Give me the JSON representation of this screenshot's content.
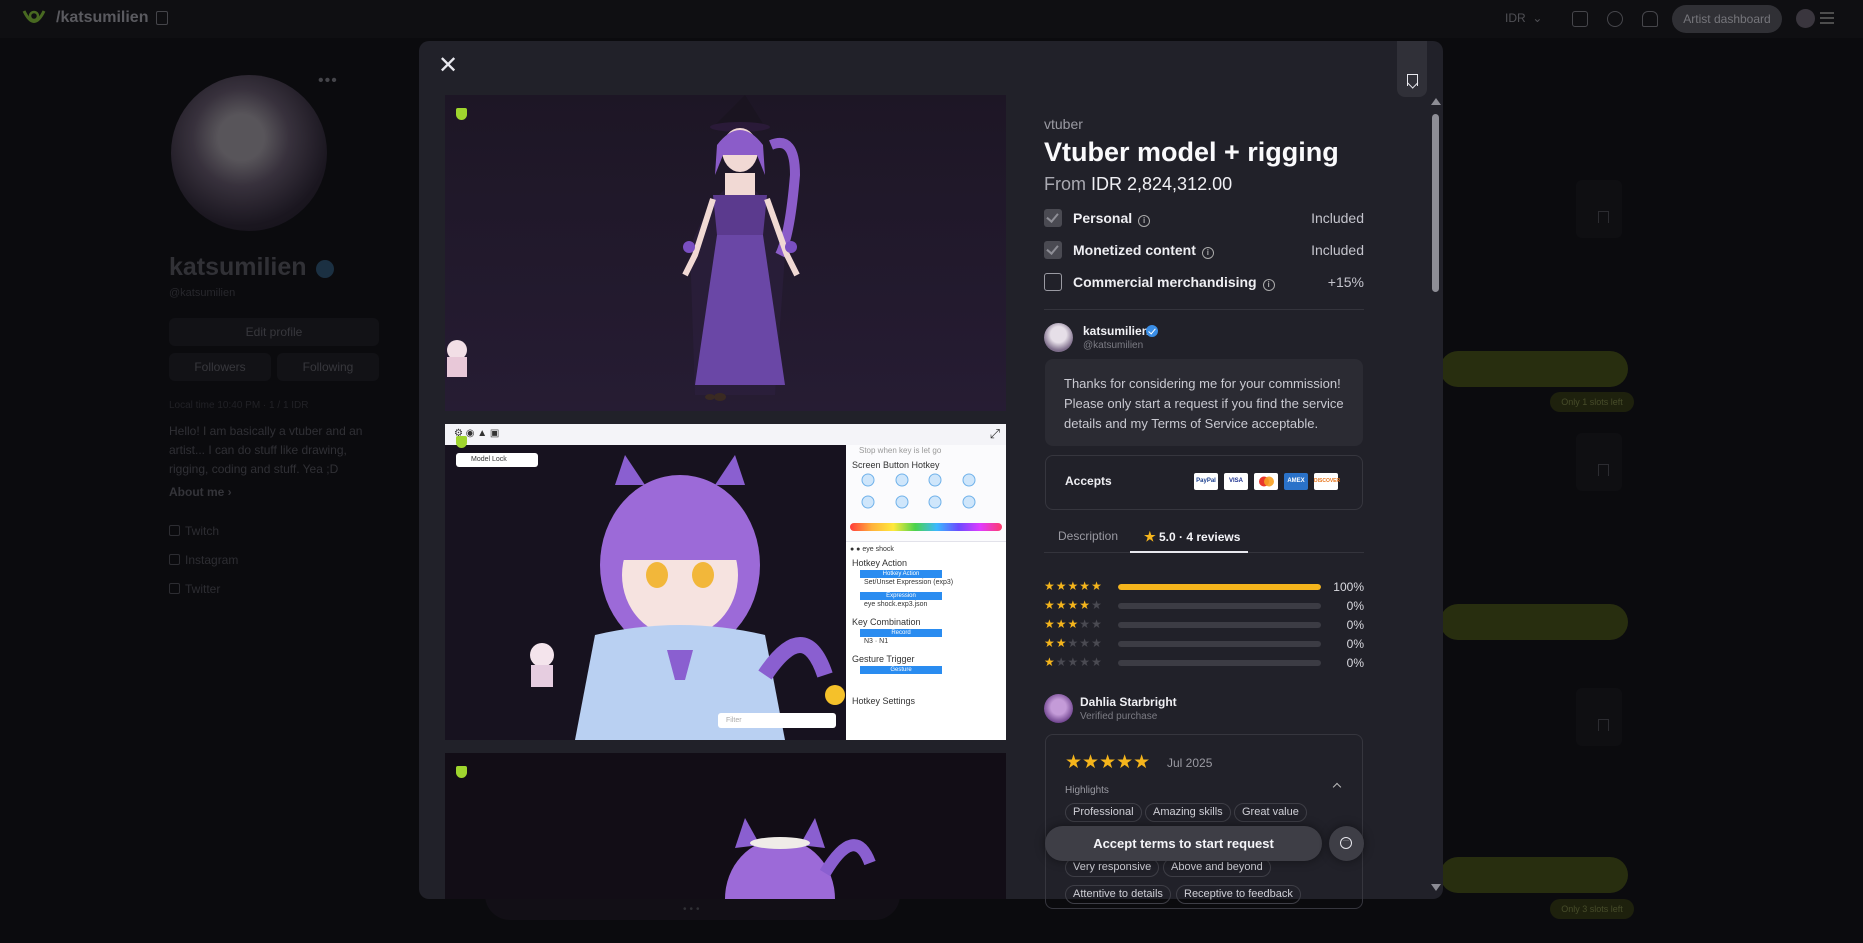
{
  "app": {
    "handle": "/katsumilien",
    "currency": "IDR",
    "artist_dashboard": "Artist dashboard"
  },
  "profile": {
    "name": "katsumilien",
    "username": "@katsumilien",
    "edit_profile": "Edit profile",
    "followers": "Followers",
    "following": "Following",
    "meta": "Local time 10:40 PM · 1 / 1 IDR",
    "bio": "Hello! I am basically a vtuber and an artist... I can do stuff like drawing, rigging, coding and stuff. Yea ;D",
    "about_me": "About me",
    "socials": [
      "Twitch",
      "Instagram",
      "Twitter"
    ]
  },
  "background_badges": [
    "Only 1 slots left",
    "Only 3 slots left"
  ],
  "service": {
    "category": "vtuber",
    "title": "Vtuber model + rigging",
    "price_prefix": "From",
    "price": "IDR 2,824,312.00",
    "licenses": [
      {
        "label": "Personal",
        "value": "Included",
        "checked": true
      },
      {
        "label": "Monetized content",
        "value": "Included",
        "checked": true
      },
      {
        "label": "Commercial merchandising",
        "value": "+15%",
        "checked": false
      }
    ]
  },
  "seller": {
    "name": "katsumilien",
    "username": "@katsumilien",
    "message": "Thanks for considering me for your commission! Please only start a request if you find the service details and my Terms of Service acceptable."
  },
  "accepts": {
    "label": "Accepts",
    "methods": [
      "PayPal",
      "VISA",
      "Mastercard",
      "AMEX",
      "DISCOVER"
    ]
  },
  "tabs": {
    "description": "Description",
    "reviews": "5.0 · 4 reviews"
  },
  "rating_breakdown": [
    {
      "stars": 5,
      "percent": "100%",
      "fraction": 1.0
    },
    {
      "stars": 4,
      "percent": "0%",
      "fraction": 0
    },
    {
      "stars": 3,
      "percent": "0%",
      "fraction": 0
    },
    {
      "stars": 2,
      "percent": "0%",
      "fraction": 0
    },
    {
      "stars": 1,
      "percent": "0%",
      "fraction": 0
    }
  ],
  "review": {
    "name": "Dahlia Starbright",
    "verified": "Verified purchase",
    "rating": 5,
    "date": "Jul 2025",
    "highlights_label": "Highlights",
    "chips": [
      "Professional",
      "Amazing skills",
      "Great value",
      "Very responsive",
      "Above and beyond",
      "Attentive to details",
      "Receptive to feedback"
    ]
  },
  "gallery_ui": {
    "model_lock": "Model Lock",
    "stop_key": "Stop when key is let go",
    "screen_hotkey": "Screen Button Hotkey",
    "eye_shock": "eye shock",
    "hotkey_action": "Hotkey Action",
    "hotkey_action_btn": "Hotkey Action",
    "set_expression": "Set/Unset Expression (exp3)",
    "expression_btn": "Expression",
    "exp_file": "eye shock.exp3.json",
    "key_combination": "Key Combination",
    "record_btn": "Record",
    "keys": "N3 · N1",
    "gesture_trigger": "Gesture Trigger",
    "gesture_btn": "Gesture",
    "hotkey_settings": "Hotkey Settings",
    "filter": "Filter"
  },
  "cta": {
    "accept_label": "Accept terms to start request"
  },
  "colors": {
    "accent_star": "#f5b51c",
    "verified": "#3a8ee6",
    "badge_green": "#9fd52e"
  }
}
